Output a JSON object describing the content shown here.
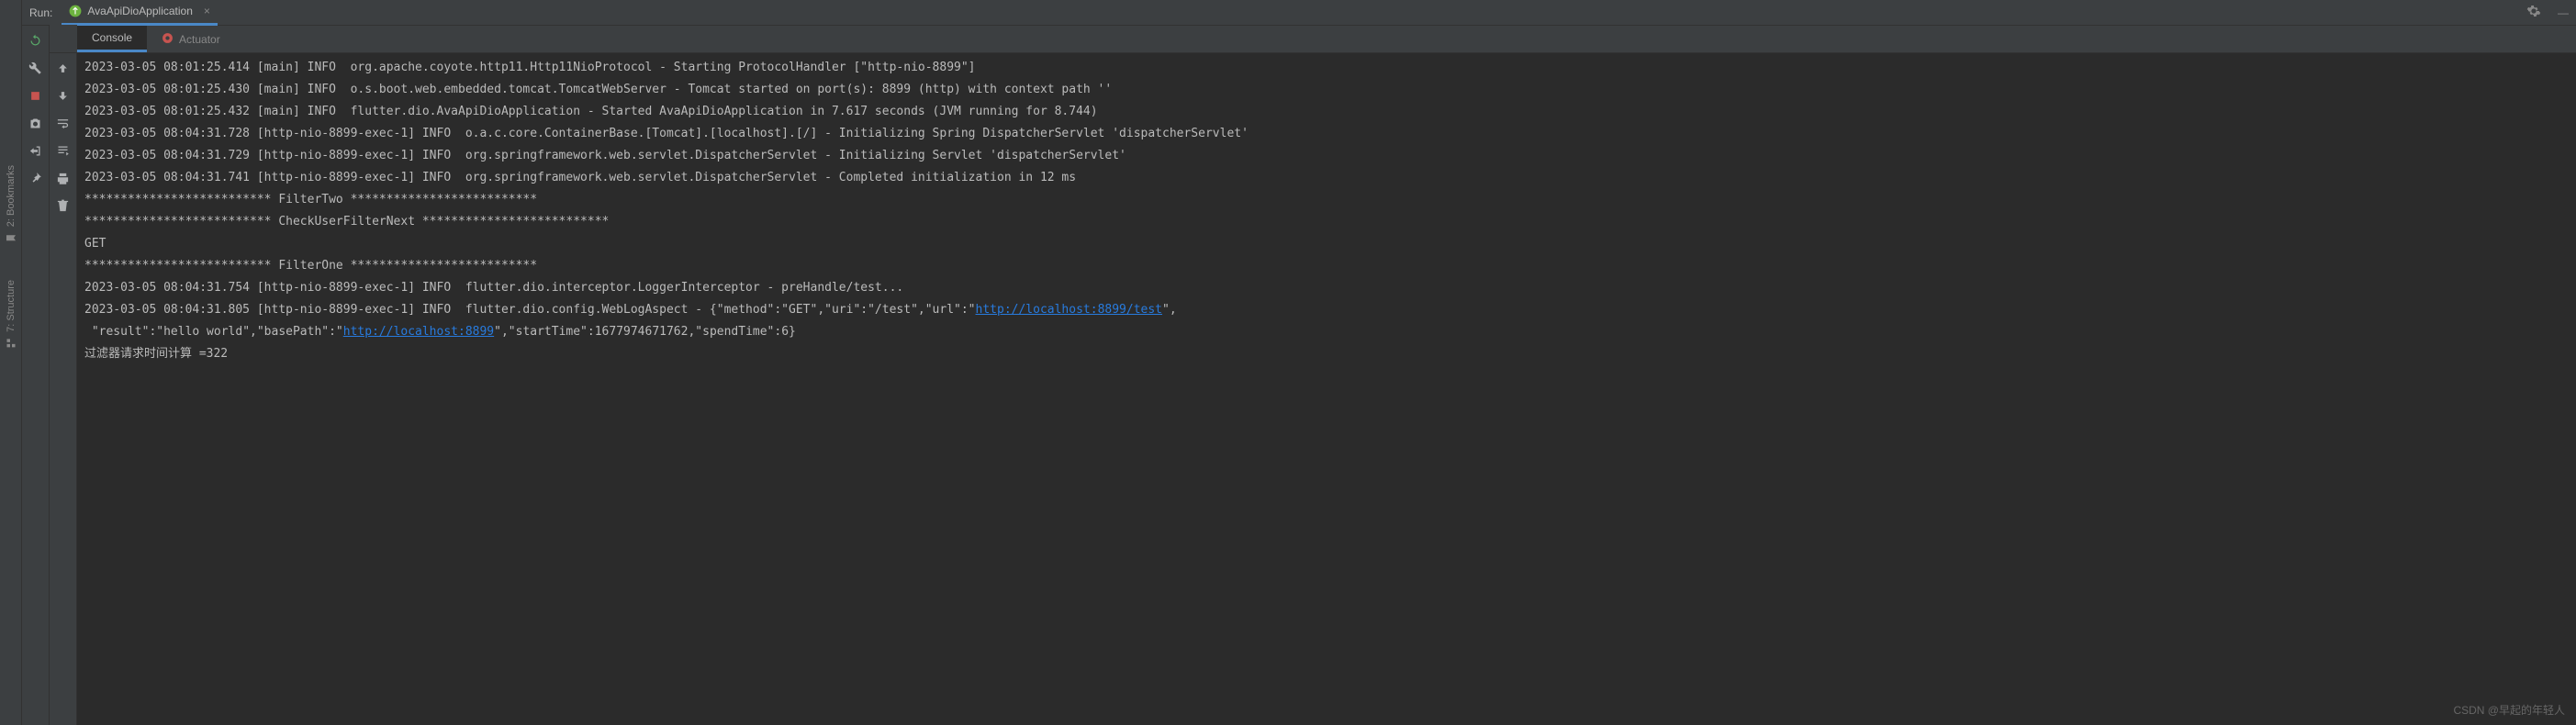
{
  "header": {
    "run_label": "Run:",
    "config_name": "AvaApiDioApplication"
  },
  "tabs": {
    "console": "Console",
    "actuator": "Actuator"
  },
  "side_labels": {
    "bookmarks": "2: Bookmarks",
    "structure": "7: Structure"
  },
  "console_lines": [
    {
      "text": "2023-03-05 08:01:25.414 [main] INFO  org.apache.coyote.http11.Http11NioProtocol - Starting ProtocolHandler [\"http-nio-8899\"]"
    },
    {
      "text": "2023-03-05 08:01:25.430 [main] INFO  o.s.boot.web.embedded.tomcat.TomcatWebServer - Tomcat started on port(s): 8899 (http) with context path ''"
    },
    {
      "text": "2023-03-05 08:01:25.432 [main] INFO  flutter.dio.AvaApiDioApplication - Started AvaApiDioApplication in 7.617 seconds (JVM running for 8.744)"
    },
    {
      "text": "2023-03-05 08:04:31.728 [http-nio-8899-exec-1] INFO  o.a.c.core.ContainerBase.[Tomcat].[localhost].[/] - Initializing Spring DispatcherServlet 'dispatcherServlet'"
    },
    {
      "text": "2023-03-05 08:04:31.729 [http-nio-8899-exec-1] INFO  org.springframework.web.servlet.DispatcherServlet - Initializing Servlet 'dispatcherServlet'"
    },
    {
      "text": "2023-03-05 08:04:31.741 [http-nio-8899-exec-1] INFO  org.springframework.web.servlet.DispatcherServlet - Completed initialization in 12 ms"
    },
    {
      "text": "************************** FilterTwo **************************"
    },
    {
      "text": "************************** CheckUserFilterNext **************************"
    },
    {
      "text": "GET"
    },
    {
      "text": "************************** FilterOne **************************"
    },
    {
      "text": "2023-03-05 08:04:31.754 [http-nio-8899-exec-1] INFO  flutter.dio.interceptor.LoggerInterceptor - preHandle/test..."
    },
    {
      "parts": [
        {
          "t": "2023-03-05 08:04:31.805 [http-nio-8899-exec-1] INFO  flutter.dio.config.WebLogAspect - {\"method\":\"GET\",\"uri\":\"/test\",\"url\":\""
        },
        {
          "t": "http://localhost:8899/test",
          "link": true
        },
        {
          "t": "\","
        }
      ]
    },
    {
      "parts": [
        {
          "t": " \"result\":\"hello world\",\"basePath\":\""
        },
        {
          "t": "http://localhost:8899",
          "link": true
        },
        {
          "t": "\",\"startTime\":1677974671762,\"spendTime\":6}"
        }
      ]
    },
    {
      "text": "过滤器请求时间计算 =322"
    }
  ],
  "watermark": "CSDN @早起的年轻人"
}
